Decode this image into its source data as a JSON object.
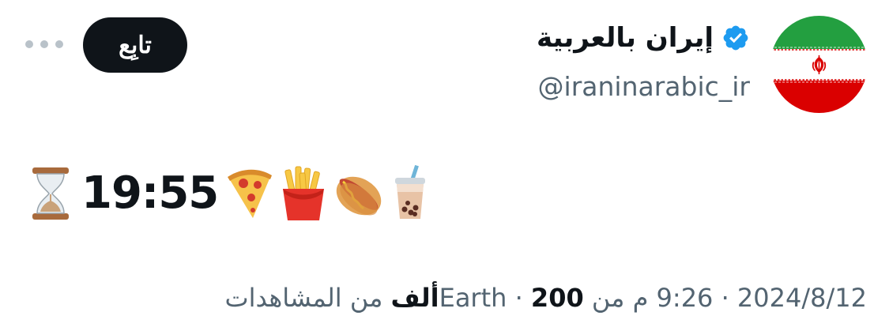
{
  "author": {
    "display_name": "إيران بالعربية",
    "handle": "@iraninarabic_ir",
    "verified": true,
    "avatar_icon": "iran-flag-icon"
  },
  "actions": {
    "follow_label": "تابِع",
    "more_icon": "more-horizontal-icon"
  },
  "tweet": {
    "time_text": "19:55",
    "emojis_left": [
      "hourglass-icon"
    ],
    "emojis_right": [
      "pizza-icon",
      "fries-icon",
      "hotdog-icon",
      "bubble-tea-icon"
    ]
  },
  "meta": {
    "date": "2024/8/12",
    "separator": "·",
    "time": "9:26 م من Earth",
    "views_count": "200ألف",
    "views_label": "من المشاهدات"
  },
  "colors": {
    "text_primary": "#0f1419",
    "text_secondary": "#536471",
    "verified_blue": "#1d9bf0",
    "follow_bg": "#0f1419"
  }
}
